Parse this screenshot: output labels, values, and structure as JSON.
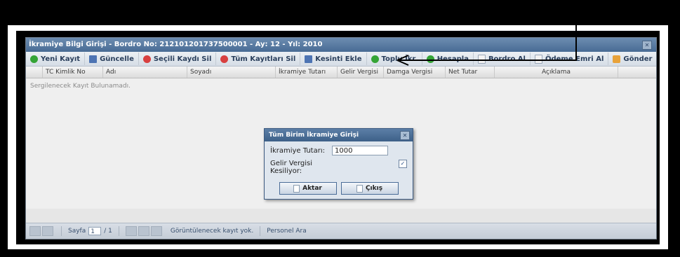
{
  "window": {
    "title": "İkramiye Bilgi Girişi - Bordro No: 212101201737500001 - Ay: 12 - Yıl: 2010",
    "close_glyph": "✕"
  },
  "toolbar": {
    "items": [
      {
        "label": "Yeni Kayıt",
        "icon": "add-icon"
      },
      {
        "label": "Güncelle",
        "icon": "save-icon"
      },
      {
        "label": "Seçili Kaydı Sil",
        "icon": "delete-icon"
      },
      {
        "label": "Tüm Kayıtları Sil",
        "icon": "delete-all-icon"
      },
      {
        "label": "Kesinti Ekle",
        "icon": "deduction-icon"
      },
      {
        "label": "Toplu İkr.",
        "icon": "bulk-bonus-icon"
      },
      {
        "label": "Hesapla",
        "icon": "calculate-icon"
      },
      {
        "label": "Bordro Al",
        "icon": "document-icon"
      },
      {
        "label": "Ödeme Emri Al",
        "icon": "document-icon"
      },
      {
        "label": "Gönder",
        "icon": "send-icon"
      }
    ]
  },
  "grid": {
    "columns": [
      "TC Kimlik No",
      "Adı",
      "Soyadı",
      "İkramiye Tutarı",
      "Gelir Vergisi",
      "Damga Vergisi",
      "Net Tutar",
      "Açıklama"
    ],
    "empty_message": "Sergilenecek Kayıt Bulunamadı."
  },
  "pager": {
    "page_label": "Sayfa",
    "page_value": "1",
    "page_total": "/ 1",
    "status": "Görüntülenecek kayıt yok.",
    "search_label": "Personel Ara"
  },
  "dialog": {
    "title": "Tüm Birim İkramiye Girişi",
    "amount_label": "İkramiye Tutarı:",
    "amount_value": "1000",
    "tax_label": "Gelir Vergisi Kesiliyor:",
    "tax_checked": true,
    "check_glyph": "✓",
    "submit_label": "Aktar",
    "cancel_label": "Çıkış"
  },
  "colors": {
    "title_bar": "#486b94",
    "accent": "#3d6088"
  }
}
